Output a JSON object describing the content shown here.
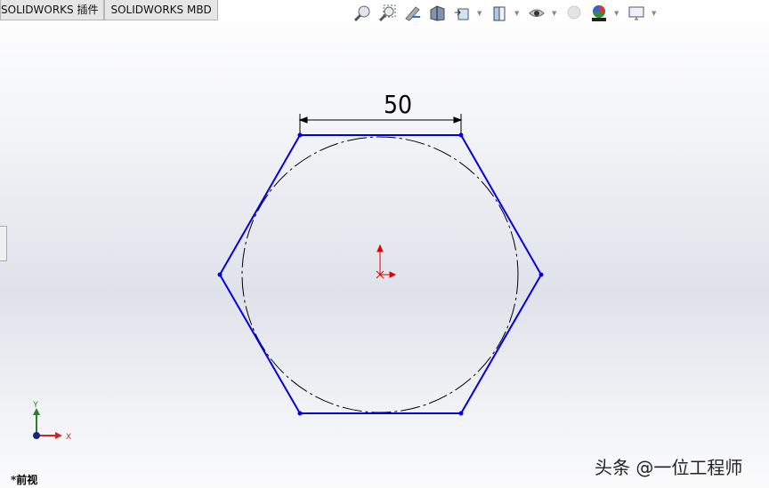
{
  "tabs": [
    {
      "label": "SOLIDWORKS 插件"
    },
    {
      "label": "SOLIDWORKS MBD"
    }
  ],
  "toolbar": [
    "zoom-to-fit-icon",
    "zoom-to-area-icon",
    "previous-view-icon",
    "section-view-icon",
    "view-orientation-icon",
    "display-style-icon",
    "hide-show-items-icon",
    "edit-appearance-icon",
    "apply-scene-icon",
    "view-settings-icon"
  ],
  "sketch": {
    "dimension": "50"
  },
  "triad": {
    "x": "X",
    "y": "Y"
  },
  "view_label": "*前视",
  "watermark": "头条 @一位工程师",
  "colors": {
    "sketch": "#0000e0",
    "origin": "#e00000",
    "construction": "#000000"
  }
}
